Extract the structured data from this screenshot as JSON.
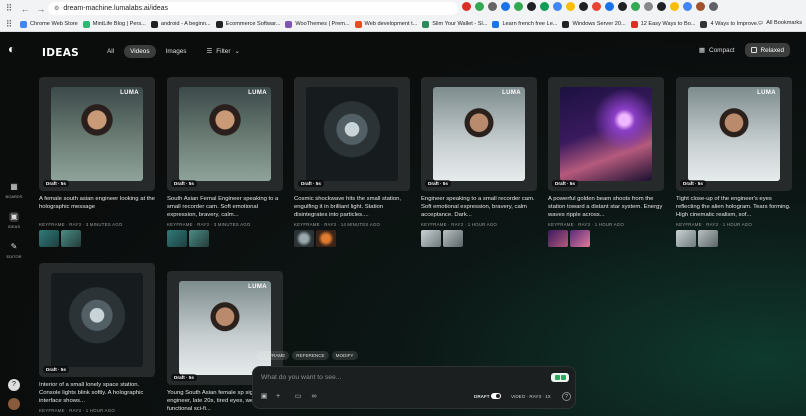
{
  "browser": {
    "url": "dream-machine.lumalabs.ai/ideas",
    "bookmarks": [
      {
        "label": "Chrome Web Store",
        "color": "#4285f4"
      },
      {
        "label": "MintLife Blog | Pers...",
        "color": "#2eb872"
      },
      {
        "label": "android - A beginn...",
        "color": "#202124"
      },
      {
        "label": "Ecommerce Softwar...",
        "color": "#222"
      },
      {
        "label": "WooThemes | Prem...",
        "color": "#7f54b3"
      },
      {
        "label": "Web development t...",
        "color": "#e44d26"
      },
      {
        "label": "Slim Your Wallet - Sl...",
        "color": "#2a8c5a"
      },
      {
        "label": "Learn french free Le...",
        "color": "#1a73e8"
      },
      {
        "label": "Windows Server 20...",
        "color": "#222"
      },
      {
        "label": "12 Easy Ways to Bo...",
        "color": "#d93025"
      },
      {
        "label": "4 Ways to Improve...",
        "color": "#333"
      }
    ],
    "all_bookmarks": "All Bookmarks"
  },
  "rail": {
    "boards": "BOARDS",
    "ideas": "IDEAS",
    "editor": "EDITOR"
  },
  "header": {
    "title": "IDEAS",
    "tabs": [
      "All",
      "Videos",
      "Images"
    ],
    "active_tab": "Videos",
    "filter_label": "Filter",
    "view_compact": "Compact",
    "view_relaxed": "Relaxed"
  },
  "cards": [
    {
      "desc": "A female south asian engineer looking at the holographic message",
      "meta": "KEYFRAME · RAY3 · 3 MINUTES AGO",
      "draft": "Draft · 5s",
      "luma": "LUMA",
      "scene": "portrait-console"
    },
    {
      "desc": "South Asian Femal Engineer speaking to a small recorder cam. Soft emotional expression, bravery, calm...",
      "meta": "KEYFRAME · RAY3 · 3 MINUTES AGO",
      "draft": "Draft · 5s",
      "luma": "LUMA",
      "scene": "portrait-console"
    },
    {
      "desc": "Cosmic shockwave hits the small station, engulfing it in brilliant light. Station disintegrates into particles....",
      "meta": "KEYFRAME · RAY3 · 14 MINUTES AGO",
      "draft": "Draft · 5s",
      "luma": "",
      "scene": "corridor"
    },
    {
      "desc": "Engineer speaking to a small recorder cam. Soft emotional expression, bravery, calm acceptance. Dark...",
      "meta": "KEYFRAME · RAY3 · 1 HOUR AGO",
      "draft": "Draft · 5s",
      "luma": "LUMA",
      "scene": "portrait-white"
    },
    {
      "desc": "A powerful golden beam shoots from the station toward a distant star system. Energy waves ripple across...",
      "meta": "KEYFRAME · RAY3 · 1 HOUR AGO",
      "draft": "Draft · 5s",
      "luma": "",
      "scene": "space"
    },
    {
      "desc": "Tight close-up of the engineer's eyes reflecting the alien hologram. Tears forming. High cinematic realism, sof...",
      "meta": "KEYFRAME · RAY3 · 1 HOUR AGO",
      "draft": "Draft · 5s",
      "luma": "LUMA",
      "scene": "portrait-white"
    },
    {
      "desc": "Interior of a small lonely space station. Console lights blink softly. A holographic interface shows...",
      "meta": "KEYFRAME · RAY3 · 1 HOUR AGO",
      "draft": "Draft · 5s",
      "luma": "",
      "scene": "corridor"
    },
    {
      "desc": "Young South Asian female sp signal engineer, late 20s, tired eyes, wearing a functional sci-fi...",
      "meta": "",
      "draft": "Draft · 5s",
      "luma": "LUMA",
      "scene": "portrait-white"
    }
  ],
  "prompt": {
    "tags": [
      "KEYFRAME",
      "REFERENCE",
      "MODIFY"
    ],
    "placeholder": "What do you want to see...",
    "draft_label": "DRAFT",
    "model": "VIDEO · RAY3 · 1X",
    "help": "?"
  },
  "colors": {
    "accent_green": "#2fa860",
    "app_bg": "#0b0d0d"
  }
}
